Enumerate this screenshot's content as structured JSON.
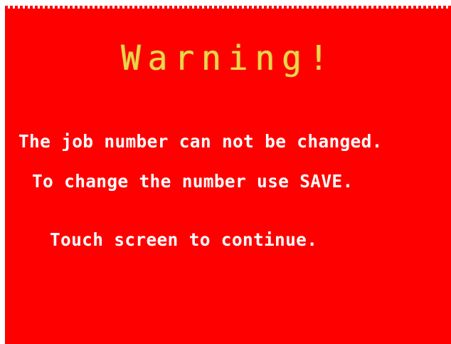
{
  "dialog": {
    "title": "Warning!",
    "message_line1": "The job number can not be changed.",
    "message_line2": "To change the number use SAVE.",
    "instruction": "Touch screen to continue."
  },
  "colors": {
    "background": "#fe0000",
    "title": "#ecd54c",
    "text": "#ffffff"
  }
}
